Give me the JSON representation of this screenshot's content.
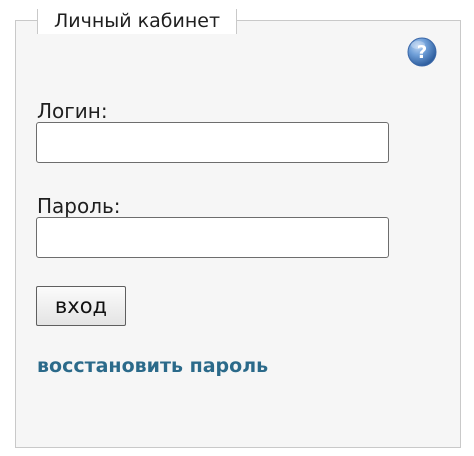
{
  "panel": {
    "title": "Личный кабинет"
  },
  "help": {
    "icon": "help-question-icon",
    "glyph": "?",
    "color": "#4a78b8"
  },
  "login": {
    "label": "Логин:",
    "value": "",
    "placeholder": ""
  },
  "password": {
    "label": "Пароль:",
    "value": "",
    "placeholder": ""
  },
  "submit": {
    "label": "вход"
  },
  "restore": {
    "label": "восстановить пароль",
    "color": "#2b6a8a"
  }
}
